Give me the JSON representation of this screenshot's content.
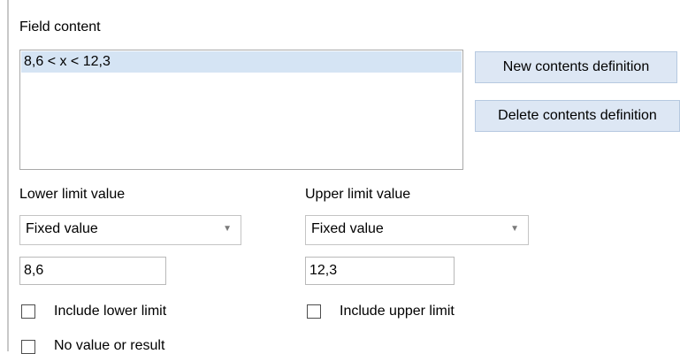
{
  "field_content": {
    "label": "Field content",
    "items": [
      "8,6 < x  < 12,3"
    ]
  },
  "buttons": {
    "new_contents": "New contents definition",
    "delete_contents": "Delete contents definition"
  },
  "lower": {
    "label": "Lower limit value",
    "selected": "Fixed value",
    "value": "8,6",
    "include_label": "Include lower limit",
    "include_checked": false
  },
  "upper": {
    "label": "Upper limit value",
    "selected": "Fixed value",
    "value": "12,3",
    "include_label": "Include upper limit",
    "include_checked": false
  },
  "no_value": {
    "label": "No value or result",
    "checked": false
  },
  "icons": {
    "dropdown": "chevron-down-icon"
  }
}
